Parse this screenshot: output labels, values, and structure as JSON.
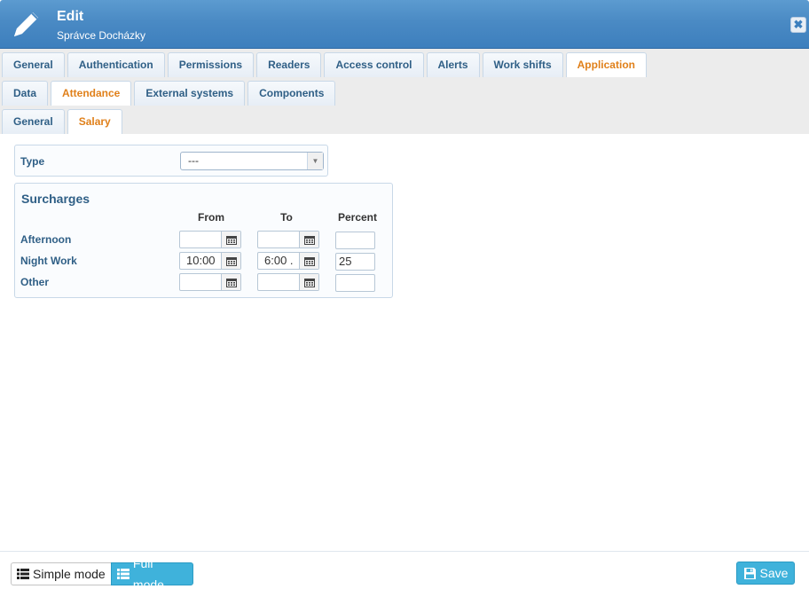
{
  "header": {
    "title": "Edit",
    "subtitle": "Správce Docházky"
  },
  "tabs_row1": [
    {
      "label": "General"
    },
    {
      "label": "Authentication"
    },
    {
      "label": "Permissions"
    },
    {
      "label": "Readers"
    },
    {
      "label": "Access control"
    },
    {
      "label": "Alerts"
    },
    {
      "label": "Work shifts"
    },
    {
      "label": "Application",
      "active": true
    }
  ],
  "tabs_row2": [
    {
      "label": "Data"
    },
    {
      "label": "Attendance",
      "active": true
    },
    {
      "label": "External systems"
    },
    {
      "label": "Components"
    }
  ],
  "tabs_row3": [
    {
      "label": "General"
    },
    {
      "label": "Salary",
      "active": true
    }
  ],
  "type_field": {
    "label": "Type",
    "value": "---"
  },
  "surcharges": {
    "title": "Surcharges",
    "col_from": "From",
    "col_to": "To",
    "col_percent": "Percent",
    "rows": [
      {
        "label": "Afternoon",
        "from": "",
        "to": "",
        "percent": ""
      },
      {
        "label": "Night Work",
        "from": "10:00",
        "to": "6:00 .",
        "percent": "25"
      },
      {
        "label": "Other",
        "from": "",
        "to": "",
        "percent": ""
      }
    ]
  },
  "footer": {
    "simple_mode": "Simple mode",
    "full_mode": "Full mode",
    "save": "Save"
  }
}
